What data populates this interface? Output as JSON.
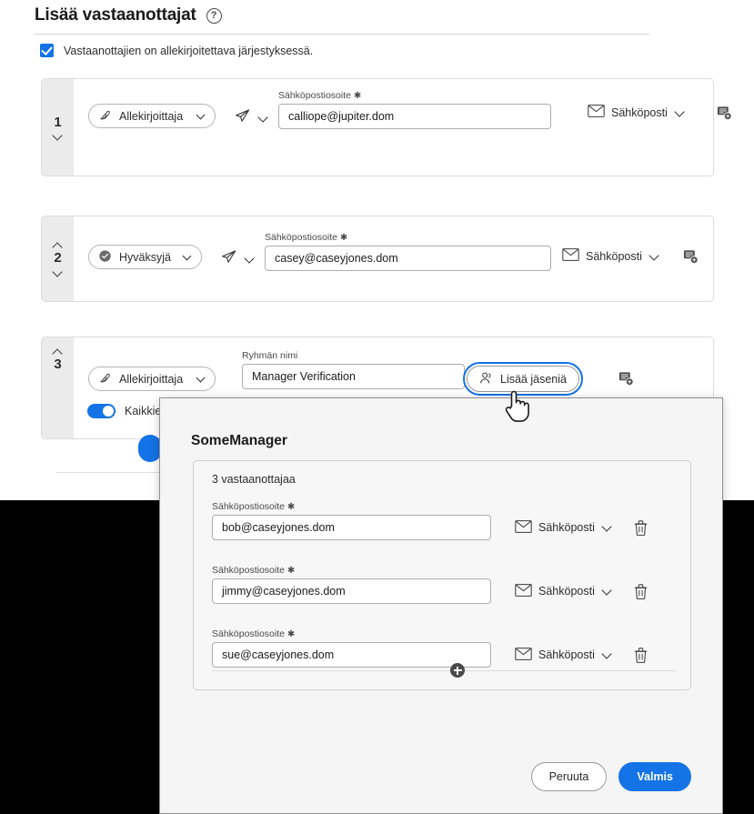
{
  "page": {
    "title": "Lisää vastaanottajat",
    "help_icon": "question-circle-icon",
    "order_checkbox_label": "Vastaanottajien on allekirjoitettava järjestyksessä.",
    "order_checkbox_checked": true,
    "accent_color": "#1473e6"
  },
  "labels": {
    "email_label": "Sähköpostiosoite",
    "required_mark": "✱",
    "group_name_label": "Ryhmän nimi",
    "delivery_email": "Sähköposti"
  },
  "recipients": [
    {
      "number": "1",
      "role": "Allekirjoittaja",
      "role_icon": "signature-pen-icon",
      "send_icon": "paper-plane-icon",
      "field_label": "Sähköpostiosoite",
      "email": "calliope@jupiter.dom",
      "delivery": "Sähköposti",
      "delivery_icon": "envelope-icon",
      "note_icon": "add-private-message-icon",
      "delete_icon": "trash-icon",
      "collapse_up": false,
      "collapse_down": true
    },
    {
      "number": "2",
      "role": "Hyväksyjä",
      "role_icon": "check-circle-icon",
      "send_icon": "paper-plane-icon",
      "field_label": "Sähköpostiosoite",
      "email": "casey@caseyjones.dom",
      "delivery": "Sähköposti",
      "delivery_icon": "envelope-icon",
      "note_icon": "add-private-message-icon",
      "delete_icon": "trash-icon",
      "collapse_up": true,
      "collapse_down": true
    },
    {
      "number": "3",
      "role": "Allekirjoittaja",
      "role_icon": "signature-pen-icon",
      "field_label": "Ryhmän nimi",
      "group_name": "Manager Verification",
      "members_button": "Lisää jäseniä",
      "members_icon": "people-icon",
      "note_icon": "add-private-message-icon",
      "delete_icon": "trash-icon",
      "toggle_label": "Kaikkien",
      "toggle_on": true,
      "collapse_up": true,
      "collapse_down": false
    }
  ],
  "modal": {
    "title": "SomeManager",
    "count_text": "3 vastaanottajaa",
    "rows": [
      {
        "label": "Sähköpostiosoite",
        "email": "bob@caseyjones.dom",
        "delivery": "Sähköposti",
        "delivery_icon": "envelope-icon",
        "delete_icon": "trash-icon"
      },
      {
        "label": "Sähköpostiosoite",
        "email": "jimmy@caseyjones.dom",
        "delivery": "Sähköposti",
        "delivery_icon": "envelope-icon",
        "delete_icon": "trash-icon"
      },
      {
        "label": "Sähköpostiosoite",
        "email": "sue@caseyjones.dom",
        "delivery": "Sähköposti",
        "delivery_icon": "envelope-icon",
        "delete_icon": "trash-icon"
      }
    ],
    "add_icon": "plus-circle-icon",
    "cancel_label": "Peruuta",
    "confirm_label": "Valmis"
  },
  "cursor": {
    "icon": "pointing-hand-cursor"
  }
}
